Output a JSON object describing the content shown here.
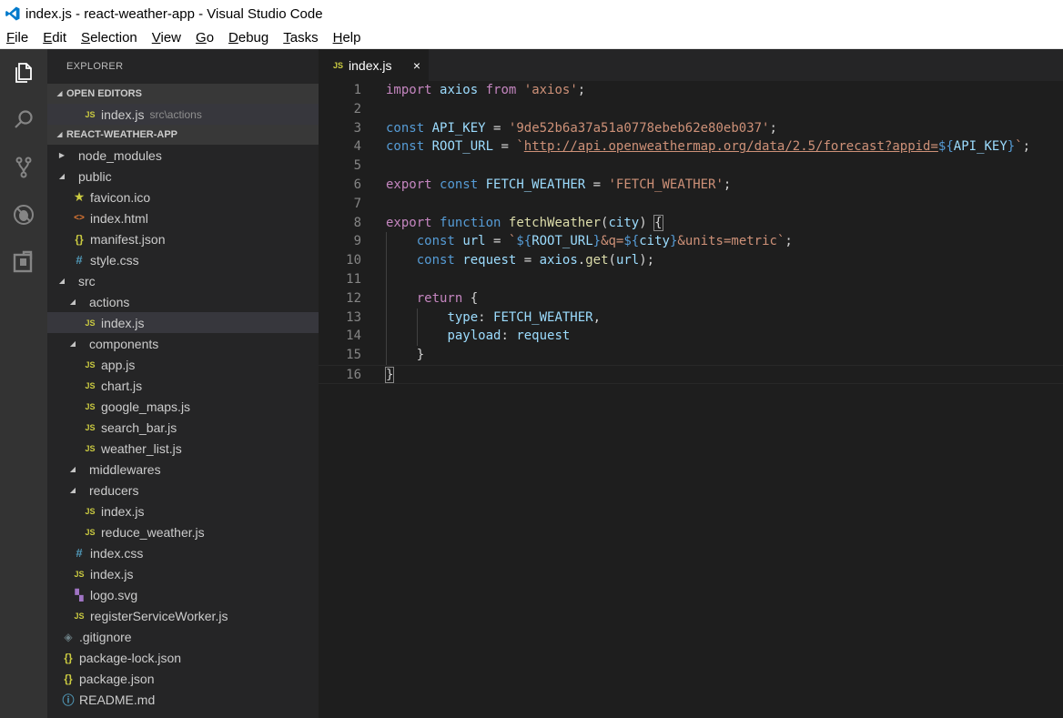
{
  "window": {
    "title": "index.js - react-weather-app - Visual Studio Code"
  },
  "menu": [
    {
      "underline": "F",
      "rest": "ile"
    },
    {
      "underline": "E",
      "rest": "dit"
    },
    {
      "underline": "S",
      "rest": "election"
    },
    {
      "underline": "V",
      "rest": "iew"
    },
    {
      "underline": "G",
      "rest": "o"
    },
    {
      "underline": "D",
      "rest": "ebug"
    },
    {
      "underline": "T",
      "rest": "asks"
    },
    {
      "underline": "H",
      "rest": "elp"
    }
  ],
  "activity": [
    "explorer-icon",
    "search-icon",
    "source-control-icon",
    "debug-icon",
    "extensions-icon"
  ],
  "explorer": {
    "title": "EXPLORER",
    "open_editors_label": "OPEN EDITORS",
    "open_editors": [
      {
        "name": "index.js",
        "path": "src\\actions",
        "icon": "js"
      }
    ],
    "project_label": "REACT-WEATHER-APP",
    "tree": [
      {
        "name": "node_modules",
        "type": "folder",
        "expanded": false,
        "depth": 1
      },
      {
        "name": "public",
        "type": "folder",
        "expanded": true,
        "depth": 1
      },
      {
        "name": "favicon.ico",
        "type": "file",
        "icon": "star",
        "depth": 2
      },
      {
        "name": "index.html",
        "type": "file",
        "icon": "html",
        "depth": 2
      },
      {
        "name": "manifest.json",
        "type": "file",
        "icon": "json",
        "depth": 2
      },
      {
        "name": "style.css",
        "type": "file",
        "icon": "css",
        "depth": 2
      },
      {
        "name": "src",
        "type": "folder",
        "expanded": true,
        "depth": 1
      },
      {
        "name": "actions",
        "type": "folder",
        "expanded": true,
        "depth": 2
      },
      {
        "name": "index.js",
        "type": "file",
        "icon": "js",
        "depth": 3,
        "selected": true
      },
      {
        "name": "components",
        "type": "folder",
        "expanded": true,
        "depth": 2
      },
      {
        "name": "app.js",
        "type": "file",
        "icon": "js",
        "depth": 3
      },
      {
        "name": "chart.js",
        "type": "file",
        "icon": "js",
        "depth": 3
      },
      {
        "name": "google_maps.js",
        "type": "file",
        "icon": "js",
        "depth": 3
      },
      {
        "name": "search_bar.js",
        "type": "file",
        "icon": "js",
        "depth": 3
      },
      {
        "name": "weather_list.js",
        "type": "file",
        "icon": "js",
        "depth": 3
      },
      {
        "name": "middlewares",
        "type": "folder",
        "expanded": true,
        "depth": 2
      },
      {
        "name": "reducers",
        "type": "folder",
        "expanded": true,
        "depth": 2
      },
      {
        "name": "index.js",
        "type": "file",
        "icon": "js",
        "depth": 3
      },
      {
        "name": "reduce_weather.js",
        "type": "file",
        "icon": "js",
        "depth": 3
      },
      {
        "name": "index.css",
        "type": "file",
        "icon": "css",
        "depth": 2
      },
      {
        "name": "index.js",
        "type": "file",
        "icon": "js",
        "depth": 2
      },
      {
        "name": "logo.svg",
        "type": "file",
        "icon": "svg",
        "depth": 2
      },
      {
        "name": "registerServiceWorker.js",
        "type": "file",
        "icon": "js",
        "depth": 2
      },
      {
        "name": ".gitignore",
        "type": "file",
        "icon": "git",
        "depth": 1
      },
      {
        "name": "package-lock.json",
        "type": "file",
        "icon": "json",
        "depth": 1
      },
      {
        "name": "package.json",
        "type": "file",
        "icon": "json",
        "depth": 1
      },
      {
        "name": "README.md",
        "type": "file",
        "icon": "info",
        "depth": 1
      }
    ]
  },
  "icon_glyphs": {
    "js": "JS",
    "html": "<>",
    "json": "{}",
    "css": "#",
    "star": "★",
    "svg": "▚",
    "git": "◈",
    "info": "ⓘ"
  },
  "editor": {
    "tab": {
      "icon": "JS",
      "label": "index.js",
      "close": "×"
    },
    "lines": [
      [
        [
          "kc",
          "import"
        ],
        [
          "p",
          " "
        ],
        [
          "var",
          "axios"
        ],
        [
          "p",
          " "
        ],
        [
          "kc",
          "from"
        ],
        [
          "p",
          " "
        ],
        [
          "str",
          "'axios'"
        ],
        [
          "p",
          ";"
        ]
      ],
      [],
      [
        [
          "kw",
          "const"
        ],
        [
          "p",
          " "
        ],
        [
          "var",
          "API_KEY"
        ],
        [
          "p",
          " = "
        ],
        [
          "str",
          "'9de52b6a37a51a0778ebeb62e80eb037'"
        ],
        [
          "p",
          ";"
        ]
      ],
      [
        [
          "kw",
          "const"
        ],
        [
          "p",
          " "
        ],
        [
          "var",
          "ROOT_URL"
        ],
        [
          "p",
          " = "
        ],
        [
          "str",
          "`"
        ],
        [
          "url",
          "http://api.openweathermap.org/data/2.5/forecast?appid="
        ],
        [
          "tpl",
          "${"
        ],
        [
          "var",
          "API_KEY"
        ],
        [
          "tpl",
          "}"
        ],
        [
          "str",
          "`"
        ],
        [
          "p",
          ";"
        ]
      ],
      [],
      [
        [
          "kc",
          "export"
        ],
        [
          "p",
          " "
        ],
        [
          "kw",
          "const"
        ],
        [
          "p",
          " "
        ],
        [
          "var",
          "FETCH_WEATHER"
        ],
        [
          "p",
          " = "
        ],
        [
          "str",
          "'FETCH_WEATHER'"
        ],
        [
          "p",
          ";"
        ]
      ],
      [],
      [
        [
          "kc",
          "export"
        ],
        [
          "p",
          " "
        ],
        [
          "kw",
          "function"
        ],
        [
          "p",
          " "
        ],
        [
          "fn",
          "fetchWeather"
        ],
        [
          "p",
          "("
        ],
        [
          "var",
          "city"
        ],
        [
          "p",
          ") "
        ],
        [
          "brk",
          "{"
        ]
      ],
      [
        [
          "p",
          "    "
        ],
        [
          "kw",
          "const"
        ],
        [
          "p",
          " "
        ],
        [
          "var",
          "url"
        ],
        [
          "p",
          " = "
        ],
        [
          "str",
          "`"
        ],
        [
          "tpl",
          "${"
        ],
        [
          "var",
          "ROOT_URL"
        ],
        [
          "tpl",
          "}"
        ],
        [
          "str",
          "&q="
        ],
        [
          "tpl",
          "${"
        ],
        [
          "var",
          "city"
        ],
        [
          "tpl",
          "}"
        ],
        [
          "str",
          "&units=metric`"
        ],
        [
          "p",
          ";"
        ]
      ],
      [
        [
          "p",
          "    "
        ],
        [
          "kw",
          "const"
        ],
        [
          "p",
          " "
        ],
        [
          "var",
          "request"
        ],
        [
          "p",
          " = "
        ],
        [
          "var",
          "axios"
        ],
        [
          "p",
          "."
        ],
        [
          "fn",
          "get"
        ],
        [
          "p",
          "("
        ],
        [
          "var",
          "url"
        ],
        [
          "p",
          ");"
        ]
      ],
      [],
      [
        [
          "p",
          "    "
        ],
        [
          "kc",
          "return"
        ],
        [
          "p",
          " {"
        ]
      ],
      [
        [
          "p",
          "        "
        ],
        [
          "var",
          "type"
        ],
        [
          "p",
          ": "
        ],
        [
          "var",
          "FETCH_WEATHER"
        ],
        [
          "p",
          ","
        ]
      ],
      [
        [
          "p",
          "        "
        ],
        [
          "var",
          "payload"
        ],
        [
          "p",
          ": "
        ],
        [
          "var",
          "request"
        ]
      ],
      [
        [
          "p",
          "    }"
        ]
      ],
      [
        [
          "brk",
          "}"
        ]
      ]
    ]
  }
}
